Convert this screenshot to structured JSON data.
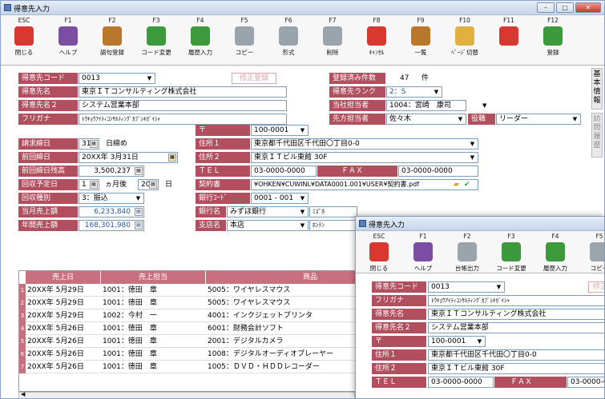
{
  "main": {
    "title": "得意先入力",
    "controls": {
      "minimize": "–",
      "maximize": "□",
      "close": "✕"
    },
    "toolbar": [
      {
        "key": "ESC",
        "label": "閉じる",
        "icon": "close-doc-icon",
        "color": "#d7382f"
      },
      {
        "key": "F1",
        "label": "ヘルプ",
        "icon": "help-icon",
        "color": "#7b4ea3"
      },
      {
        "key": "F2",
        "label": "語句登録",
        "icon": "book-icon",
        "color": "#b9772b"
      },
      {
        "key": "F3",
        "label": "コード変更",
        "icon": "shuffle-icon",
        "color": "#3c9a3c"
      },
      {
        "key": "F4",
        "label": "履歴入力",
        "icon": "down-arrow-icon",
        "color": "#3c9a3c"
      },
      {
        "key": "F5",
        "label": "コピー",
        "icon": "copy-icon",
        "color": "#9aa4ad"
      },
      {
        "key": "F6",
        "label": "形式",
        "icon": "gear-icon",
        "color": "#9aa4ad"
      },
      {
        "key": "F7",
        "label": "削除",
        "icon": "delete-icon",
        "color": "#9aa4ad"
      },
      {
        "key": "F8",
        "label": "ｷｬﾝｾﾙ",
        "icon": "cancel-icon",
        "color": "#d7382f"
      },
      {
        "key": "F9",
        "label": "一覧",
        "icon": "list-icon",
        "color": "#b9772b"
      },
      {
        "key": "F10",
        "label": "ﾍﾟｰｼﾞ切替",
        "icon": "page-switch-icon",
        "color": "#e0b040"
      },
      {
        "key": "F11",
        "label": "",
        "icon": "prohibit-icon",
        "color": "#d7382f"
      },
      {
        "key": "F12",
        "label": "登録",
        "icon": "check-icon",
        "color": "#3c9a3c"
      }
    ],
    "side_tabs": {
      "basic": "基本情報",
      "history": "訪問履歴"
    },
    "fields": {
      "code_label": "得意先コード",
      "code_value": "0013",
      "correction_label": "修正登録",
      "name_label": "得意先名",
      "name_value": "東京ＩＴコンサルティング株式会社",
      "name2_label": "得意先名２",
      "name2_value": "システム営業本部",
      "kana_label": "フリガナ",
      "kana_value": "ﾄｳｷｮｳｱｲﾃｨｺﾝｻﾙﾃｨﾝｸﾞｶﾌﾞｼｷｶﾞｲｼｬ",
      "registered_label": "登録済み件数",
      "registered_value": "47",
      "registered_unit": "件",
      "rank_label": "得意先ランク",
      "rank_value": "2：S",
      "rep_label": "当社担当者",
      "rep_value": "1004：宮崎　康司",
      "contact_label": "先方担当者",
      "contact_value": "佐々木",
      "position_label": "役職",
      "position_value": "リーダー",
      "billing_day_label": "請求締日",
      "billing_day_value": "31",
      "billing_day_suffix": "日締め",
      "last_billing_label": "前回締日",
      "last_billing_value": "20XX年 3月31日",
      "last_balance_label": "前回締日残高",
      "last_balance_value": "3,500,237",
      "collection_label": "回収予定日",
      "collection_month": "1",
      "collection_month_suffix": "ヵ月後",
      "collection_day": "20",
      "collection_day_suffix": "日",
      "collection_type_label": "回収種別",
      "collection_type_value": "3：振込",
      "month_sales_label": "当月売上額",
      "month_sales_value": "6,233,840",
      "year_sales_label": "年間売上額",
      "year_sales_value": "168,301,980",
      "zip_label": "〒",
      "zip_value": "100-0001",
      "addr1_label": "住所１",
      "addr1_value": "東京都千代田区千代田〇丁目0-0",
      "addr2_label": "住所２",
      "addr2_value": "東京ＩＴビル東館 30F",
      "tel_label": "ＴＥＬ",
      "tel_value": "03-0000-0000",
      "fax_label": "ＦＡＸ",
      "fax_value": "03-0000-0000",
      "contract_label": "契約書",
      "contract_value": "¥OHKEN¥CUWINL¥DATA0001.001¥USER¥契約書.pdf",
      "bank_code_label": "銀行ｺｰﾄﾞ",
      "bank_code_value": "0001 - 001",
      "bank_name_label": "銀行名",
      "bank_name_value": "みずほ銀行",
      "bank_name_kana": "ﾐｽﾞﾎ",
      "branch_label": "支店名",
      "branch_value": "本店",
      "branch_kana": "ﾎﾝﾃﾝ"
    },
    "grid": {
      "headers": [
        "売上日",
        "売上担当",
        "商品"
      ],
      "rows": [
        {
          "no": "1",
          "date": "20XX年 5月29日",
          "rep": "1001：徳田　章",
          "item": "5005：ワイヤレスマウス"
        },
        {
          "no": "2",
          "date": "20XX年 5月29日",
          "rep": "1001：徳田　章",
          "item": "5005：ワイヤレスマウス"
        },
        {
          "no": "3",
          "date": "20XX年 5月29日",
          "rep": "1002：今村　一",
          "item": "4001：インクジェットプリンタ"
        },
        {
          "no": "4",
          "date": "20XX年 5月26日",
          "rep": "1001：徳田　章",
          "item": "6001：財務会計ソフト"
        },
        {
          "no": "5",
          "date": "20XX年 5月26日",
          "rep": "1001：徳田　章",
          "item": "2001：デジタルカメラ"
        },
        {
          "no": "6",
          "date": "20XX年 5月26日",
          "rep": "1001：徳田　章",
          "item": "1008：デジタルオーディオプレーヤー"
        },
        {
          "no": "7",
          "date": "20XX年 5月26日",
          "rep": "1001：徳田　章",
          "item": "1005：ＤＶＤ・ＨＤＤレコーダー"
        }
      ]
    }
  },
  "sub": {
    "title": "得意先入力",
    "toolbar": [
      {
        "key": "ESC",
        "label": "閉じる",
        "icon": "close-doc-icon",
        "color": "#d7382f"
      },
      {
        "key": "F1",
        "label": "ヘルプ",
        "icon": "help-icon",
        "color": "#7b4ea3"
      },
      {
        "key": "F2",
        "label": "台帳出力",
        "icon": "print-icon",
        "color": "#9aa4ad"
      },
      {
        "key": "F3",
        "label": "コード変更",
        "icon": "shuffle-icon",
        "color": "#3c9a3c"
      },
      {
        "key": "F4",
        "label": "履歴入力",
        "icon": "down-arrow-icon",
        "color": "#3c9a3c"
      },
      {
        "key": "F5",
        "label": "コピー",
        "icon": "copy-icon",
        "color": "#9aa4ad"
      }
    ],
    "fields": {
      "code_label": "得意先コード",
      "code_value": "0013",
      "correction_label": "修正",
      "kana_label": "フリガナ",
      "kana_value": "ﾄｳｷｮｳｱｲﾃｨｺﾝｻﾙﾃｨﾝｸﾞｶﾌﾞｼｷｶﾞｲｼｬ",
      "name_label": "得意先名",
      "name_value": "東京ＩＴコンサルティング株式会社",
      "name2_label": "得意先名２",
      "name2_value": "システム営業本部",
      "zip_label": "〒",
      "zip_value": "100-0001",
      "addr1_label": "住所１",
      "addr1_value": "東京都千代田区千代田〇丁目0-0",
      "addr2_label": "住所２",
      "addr2_value": "東京ＩＴビル東館 30F",
      "tel_label": "ＴＥＬ",
      "tel_value": "03-0000-0000",
      "fax_label": "ＦＡＸ",
      "fax_value": "03-0000-0"
    }
  }
}
